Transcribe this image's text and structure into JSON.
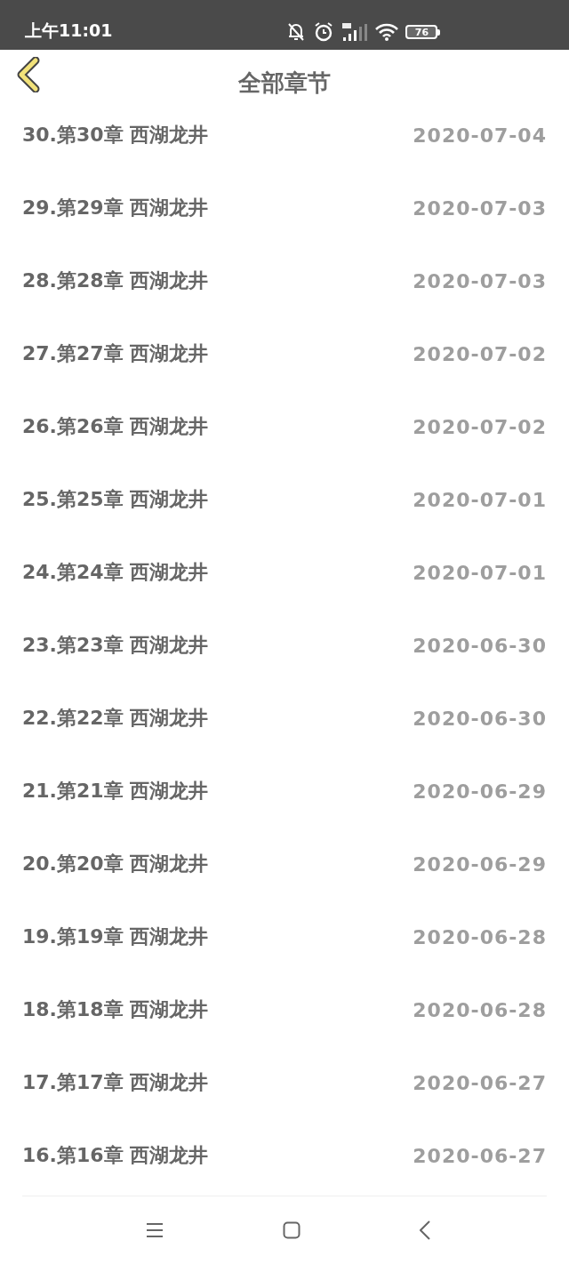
{
  "status_bar": {
    "time": "上午11:01",
    "battery": "76"
  },
  "header": {
    "title": "全部章节"
  },
  "chapters": [
    {
      "title": "30.第30章 西湖龙井",
      "date": "2020-07-04"
    },
    {
      "title": "29.第29章 西湖龙井",
      "date": "2020-07-03"
    },
    {
      "title": "28.第28章 西湖龙井",
      "date": "2020-07-03"
    },
    {
      "title": "27.第27章 西湖龙井",
      "date": "2020-07-02"
    },
    {
      "title": "26.第26章 西湖龙井",
      "date": "2020-07-02"
    },
    {
      "title": "25.第25章 西湖龙井",
      "date": "2020-07-01"
    },
    {
      "title": "24.第24章 西湖龙井",
      "date": "2020-07-01"
    },
    {
      "title": "23.第23章 西湖龙井",
      "date": "2020-06-30"
    },
    {
      "title": "22.第22章 西湖龙井",
      "date": "2020-06-30"
    },
    {
      "title": "21.第21章 西湖龙井",
      "date": "2020-06-29"
    },
    {
      "title": "20.第20章 西湖龙井",
      "date": "2020-06-29"
    },
    {
      "title": "19.第19章 西湖龙井",
      "date": "2020-06-28"
    },
    {
      "title": "18.第18章 西湖龙井",
      "date": "2020-06-28"
    },
    {
      "title": "17.第17章 西湖龙井",
      "date": "2020-06-27"
    },
    {
      "title": "16.第16章 西湖龙井",
      "date": "2020-06-27"
    }
  ]
}
